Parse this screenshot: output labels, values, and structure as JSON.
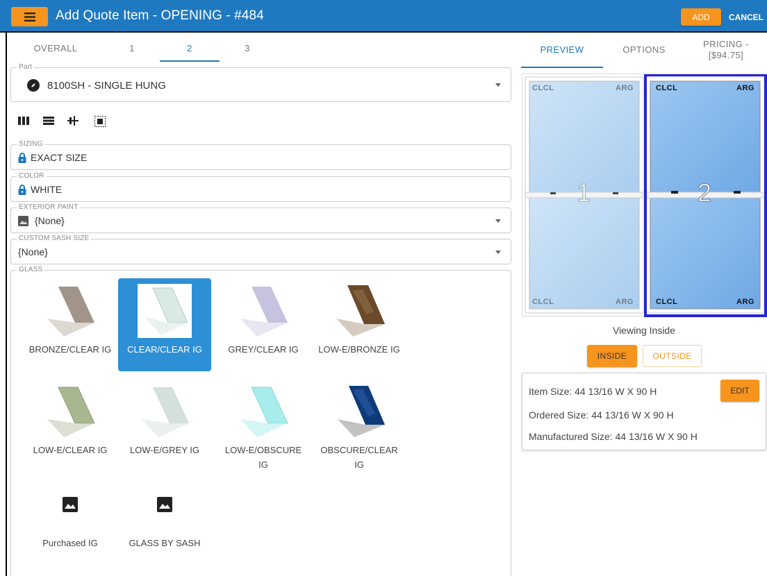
{
  "header": {
    "title": "Add Quote Item - OPENING - #484",
    "add_label": "ADD",
    "cancel_label": "CANCEL",
    "colors": {
      "bar": "#1f79c1",
      "accent": "#f7941d"
    }
  },
  "tabs": [
    "OVERALL",
    "1",
    "2",
    "3"
  ],
  "active_tab": "2",
  "part": {
    "label": "Part",
    "value": "8100SH - SINGLE HUNG"
  },
  "toolbar": {
    "icons": [
      "columns-icon",
      "rows-icon",
      "mull-icon",
      "select-frame-icon"
    ]
  },
  "sizing": {
    "label": "SIZING",
    "value": "EXACT SIZE"
  },
  "color": {
    "label": "COLOR",
    "value": "WHITE"
  },
  "exterior_paint": {
    "label": "EXTERIOR PAINT",
    "value": "{None}"
  },
  "custom_sash": {
    "label": "CUSTOM SASH SIZE",
    "value": "{None}"
  },
  "glass": {
    "label": "GLASS",
    "items": [
      {
        "label": "BRONZE/CLEAR IG",
        "tint": "#9c8f83"
      },
      {
        "label": "CLEAR/CLEAR IG",
        "tint": "#cfe3dd",
        "selected": true
      },
      {
        "label": "GREY/CLEAR IG",
        "tint": "#b8b6d6"
      },
      {
        "label": "LOW-E/BRONZE IG",
        "tint": "#6b4a2a"
      },
      {
        "label": "LOW-E/CLEAR IG",
        "tint": "#a9b790"
      },
      {
        "label": "LOW-E/GREY IG",
        "tint": "#d3e0dc"
      },
      {
        "label": "LOW-E/OBSCURE IG",
        "tint": "#9fe6e6"
      },
      {
        "label": "OBSCURE/CLEAR IG",
        "tint": "#0e3a78"
      },
      {
        "label": "Purchased IG",
        "icon": "image-icon"
      },
      {
        "label": "GLASS BY SASH",
        "icon": "image-icon"
      }
    ]
  },
  "right_tabs": {
    "preview": "PREVIEW",
    "options": "OPTIONS",
    "pricing_line1": "PRICING -",
    "pricing_line2": "[$94.75]"
  },
  "preview": {
    "units": [
      {
        "number": "1",
        "tl": "CLCL",
        "tr": "ARG",
        "bl": "CLCL",
        "br": "ARG",
        "selected": false
      },
      {
        "number": "2",
        "tl": "CLCL",
        "tr": "ARG",
        "bl": "CLCL",
        "br": "ARG",
        "selected": true
      }
    ],
    "viewing": "Viewing Inside",
    "inside_label": "INSIDE",
    "outside_label": "OUTSIDE"
  },
  "sizes": {
    "item": "Item Size: 44 13/16 W X 90 H",
    "ordered": "Ordered Size: 44 13/16 W X 90 H",
    "manufactured": "Manufactured Size: 44 13/16 W X 90 H",
    "edit_label": "EDIT"
  }
}
